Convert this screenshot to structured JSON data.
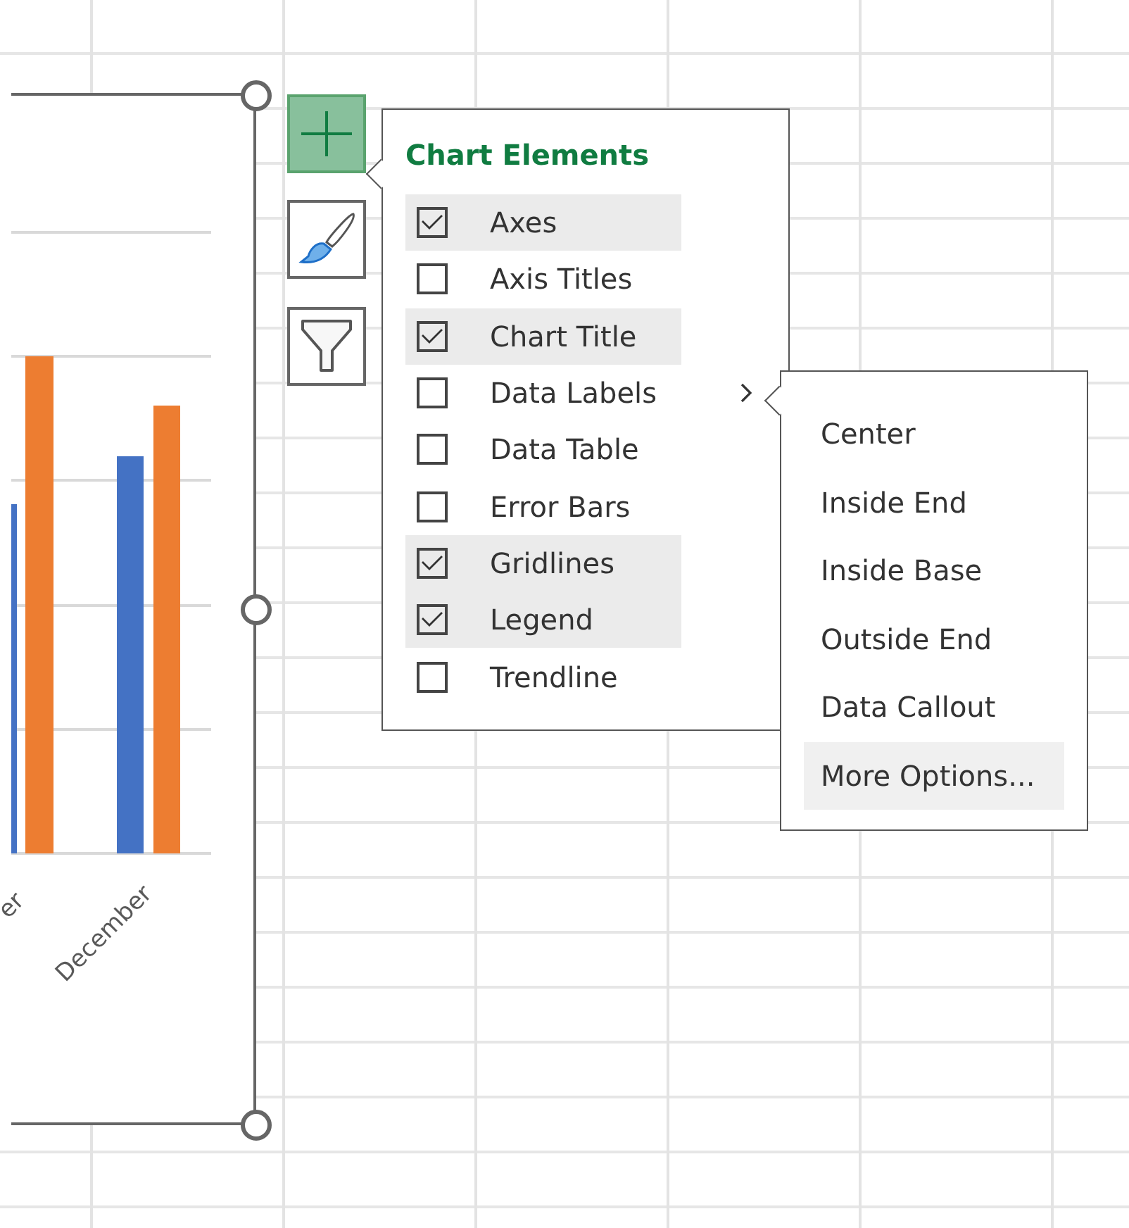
{
  "chart": {
    "category_labels": [
      "er",
      "December"
    ]
  },
  "chart_buttons": [
    {
      "kind": "elements",
      "selected": true
    },
    {
      "kind": "styles",
      "selected": false
    },
    {
      "kind": "filters",
      "selected": false
    }
  ],
  "chart_elements": {
    "title": "Chart Elements",
    "items": [
      {
        "label": "Axes",
        "checked": true,
        "has_submenu": false
      },
      {
        "label": "Axis Titles",
        "checked": false,
        "has_submenu": false
      },
      {
        "label": "Chart Title",
        "checked": true,
        "has_submenu": false
      },
      {
        "label": "Data Labels",
        "checked": false,
        "has_submenu": true
      },
      {
        "label": "Data Table",
        "checked": false,
        "has_submenu": false
      },
      {
        "label": "Error Bars",
        "checked": false,
        "has_submenu": false
      },
      {
        "label": "Gridlines",
        "checked": true,
        "has_submenu": false
      },
      {
        "label": "Legend",
        "checked": true,
        "has_submenu": false
      },
      {
        "label": "Trendline",
        "checked": false,
        "has_submenu": false
      }
    ]
  },
  "submenu": {
    "items": [
      {
        "label": "Center",
        "selected": false
      },
      {
        "label": "Inside End",
        "selected": false
      },
      {
        "label": "Inside Base",
        "selected": false
      },
      {
        "label": "Outside End",
        "selected": false
      },
      {
        "label": "Data Callout",
        "selected": false
      },
      {
        "label": "More Options...",
        "selected": true
      }
    ]
  }
}
